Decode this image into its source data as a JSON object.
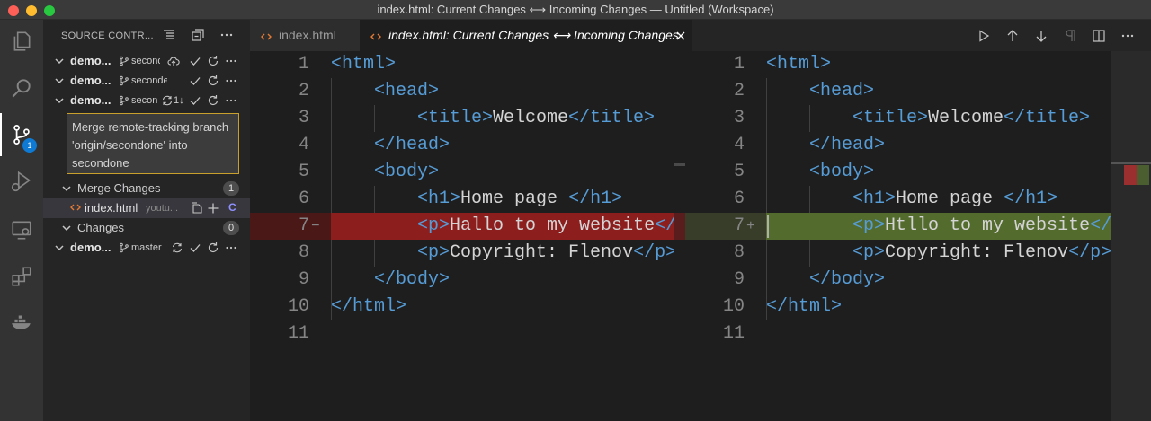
{
  "window": {
    "title": "index.html: Current Changes ⟷ Incoming Changes — Untitled (Workspace)"
  },
  "activity_bar": {
    "items": [
      "explorer-icon",
      "search-icon",
      "source-control-icon",
      "run-debug-icon",
      "remote-explorer-icon",
      "extensions-icon",
      "docker-icon"
    ],
    "scm_badge": "1"
  },
  "sidebar": {
    "title": "SOURCE CONTR...",
    "repos": [
      {
        "name": "demo...",
        "branch": "seconde",
        "sync": ""
      },
      {
        "name": "demo...",
        "branch": "seconde",
        "sync": ""
      },
      {
        "name": "demo...",
        "branch": "secon",
        "sync": "1↓"
      }
    ],
    "commit_message": "Merge remote-tracking branch 'origin/secondone' into secondone",
    "merge_changes": {
      "label": "Merge Changes",
      "count": "1"
    },
    "merge_file": {
      "name": "index.html",
      "description": "youtu...",
      "status": "C"
    },
    "changes": {
      "label": "Changes",
      "count": "0"
    },
    "last_repo": {
      "name": "demo...",
      "branch": "master"
    }
  },
  "tabs": [
    {
      "label": "index.html",
      "active": false
    },
    {
      "label": "index.html: Current Changes ⟷ Incoming Changes",
      "active": true
    }
  ],
  "editor_toolbar": [
    "run-icon",
    "arrow-up-icon",
    "arrow-down-icon",
    "pilcrow-icon",
    "split-editor-icon",
    "more-icon"
  ],
  "left_pane": {
    "marker": "−",
    "lines": [
      {
        "num": "1",
        "before": "",
        "tag_open": "<html>",
        "text": "",
        "tag_close": ""
      },
      {
        "num": "2",
        "before": "    ",
        "tag_open": "<head>",
        "text": "",
        "tag_close": ""
      },
      {
        "num": "3",
        "before": "        ",
        "tag_open": "<title>",
        "text": "Welcome",
        "tag_close": "</title>"
      },
      {
        "num": "4",
        "before": "    ",
        "tag_open": "</head>",
        "text": "",
        "tag_close": ""
      },
      {
        "num": "5",
        "before": "    ",
        "tag_open": "<body>",
        "text": "",
        "tag_close": ""
      },
      {
        "num": "6",
        "before": "        ",
        "tag_open": "<h1>",
        "text": "Home page ",
        "tag_close": "</h1>"
      },
      {
        "num": "7",
        "before": "        ",
        "tag_open": "<p>",
        "text": "Hallo to my website",
        "tag_close": "</p>"
      },
      {
        "num": "8",
        "before": "        ",
        "tag_open": "<p>",
        "text": "Copyright: Flenov",
        "tag_close": "</p>"
      },
      {
        "num": "9",
        "before": "    ",
        "tag_open": "</body>",
        "text": "",
        "tag_close": ""
      },
      {
        "num": "10",
        "before": "",
        "tag_open": "</html>",
        "text": "",
        "tag_close": ""
      },
      {
        "num": "11",
        "before": "",
        "tag_open": "",
        "text": "",
        "tag_close": ""
      }
    ]
  },
  "right_pane": {
    "marker": "+",
    "lines": [
      {
        "num": "1",
        "before": "",
        "tag_open": "<html>",
        "text": "",
        "tag_close": ""
      },
      {
        "num": "2",
        "before": "    ",
        "tag_open": "<head>",
        "text": "",
        "tag_close": ""
      },
      {
        "num": "3",
        "before": "        ",
        "tag_open": "<title>",
        "text": "Welcome",
        "tag_close": "</title>"
      },
      {
        "num": "4",
        "before": "    ",
        "tag_open": "</head>",
        "text": "",
        "tag_close": ""
      },
      {
        "num": "5",
        "before": "    ",
        "tag_open": "<body>",
        "text": "",
        "tag_close": ""
      },
      {
        "num": "6",
        "before": "        ",
        "tag_open": "<h1>",
        "text": "Home page ",
        "tag_close": "</h1>"
      },
      {
        "num": "7",
        "before": "        ",
        "tag_open": "<p>",
        "text": "Htllo to my website",
        "tag_close": "</p>"
      },
      {
        "num": "8",
        "before": "        ",
        "tag_open": "<p>",
        "text": "Copyright: Flenov",
        "tag_close": "</p>"
      },
      {
        "num": "9",
        "before": "    ",
        "tag_open": "</body>",
        "text": "",
        "tag_close": ""
      },
      {
        "num": "10",
        "before": "",
        "tag_open": "</html>",
        "text": "",
        "tag_close": ""
      },
      {
        "num": "11",
        "before": "",
        "tag_open": "",
        "text": "",
        "tag_close": ""
      }
    ]
  },
  "colors": {
    "accent": "#0e7ad3",
    "deleted": "#4b1818",
    "inserted": "#373d29",
    "tag": "#569cd6"
  }
}
